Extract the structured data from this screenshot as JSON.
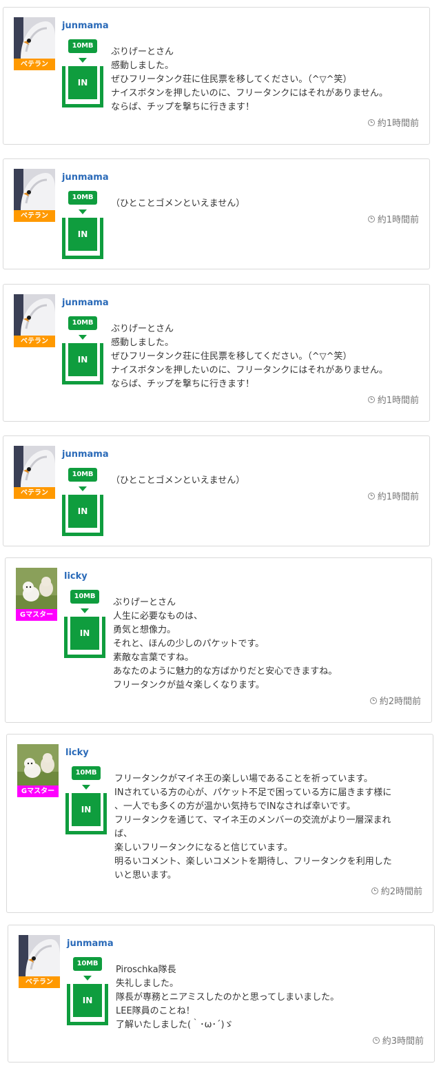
{
  "posts": [
    {
      "user": "junmama",
      "rank": "ベテラン",
      "badge": "10MB",
      "button": "IN",
      "lines": [
        "ぶりげーとさん",
        "感動しました。",
        "ぜひフリータンク荘に住民票を移してください。（^▽^笑）",
        "ナイスボタンを押したいのに、フリータンクにはそれがありません。",
        "ならば、チップを撃ちに行きます！"
      ],
      "time": "約1時間前"
    },
    {
      "user": "junmama",
      "rank": "ベテラン",
      "badge": "10MB",
      "button": "IN",
      "lines": [
        "（ひとことゴメンといえません）"
      ],
      "time": "約1時間前"
    },
    {
      "user": "junmama",
      "rank": "ベテラン",
      "badge": "10MB",
      "button": "IN",
      "lines": [
        "ぶりげーとさん",
        "感動しました。",
        "ぜひフリータンク荘に住民票を移してください。（^▽^笑）",
        "ナイスボタンを押したいのに、フリータンクにはそれがありません。",
        "ならば、チップを撃ちに行きます！"
      ],
      "time": "約1時間前"
    },
    {
      "user": "junmama",
      "rank": "ベテラン",
      "badge": "10MB",
      "button": "IN",
      "lines": [
        "（ひとことゴメンといえません）"
      ],
      "time": "約1時間前"
    },
    {
      "user": "licky",
      "rank": "Gマスター",
      "badge": "10MB",
      "button": "IN",
      "lines": [
        "ぶりげーとさん",
        "人生に必要なものは、",
        "勇気と想像力。",
        "それと、ほんの少しのパケットです。",
        "素敵な言葉ですね。",
        "あなたのように魅力的な方ばかりだと安心できますね。",
        "フリータンクが益々楽しくなります。"
      ],
      "time": "約2時間前"
    },
    {
      "user": "licky",
      "rank": "Gマスター",
      "badge": "10MB",
      "button": "IN",
      "lines": [
        "フリータンクがマイネ王の楽しい場であることを祈っています。",
        "INされている方の心が、パケット不足で困っている方に届きます様に",
        "、一人でも多くの方が温かい気持ちでINなされば幸いです。",
        "フリータンクを通じて、マイネ王のメンバーの交流がより一層深まれ",
        "ば、",
        "楽しいフリータンクになると信じています。",
        "明るいコメント、楽しいコメントを期待し、フリータンクを利用した",
        "いと思います。"
      ],
      "time": "約2時間前"
    },
    {
      "user": "junmama",
      "rank": "ベテラン",
      "badge": "10MB",
      "button": "IN",
      "lines": [
        "Piroschka隊長",
        "失礼しました。",
        "隊長が専務とニアミスしたのかと思ってしまいました。",
        "LEE隊員のことね！",
        "了解いたしました(｀･ω･´)ゞ"
      ],
      "time": "約3時間前"
    }
  ],
  "colors": {
    "username": "#2a6ab8",
    "veteran": "#ff9900",
    "gmaster": "#ff00ff",
    "green": "#0f9d3e"
  },
  "icons": [
    "clock-icon",
    "swan-avatar",
    "dogs-avatar"
  ]
}
